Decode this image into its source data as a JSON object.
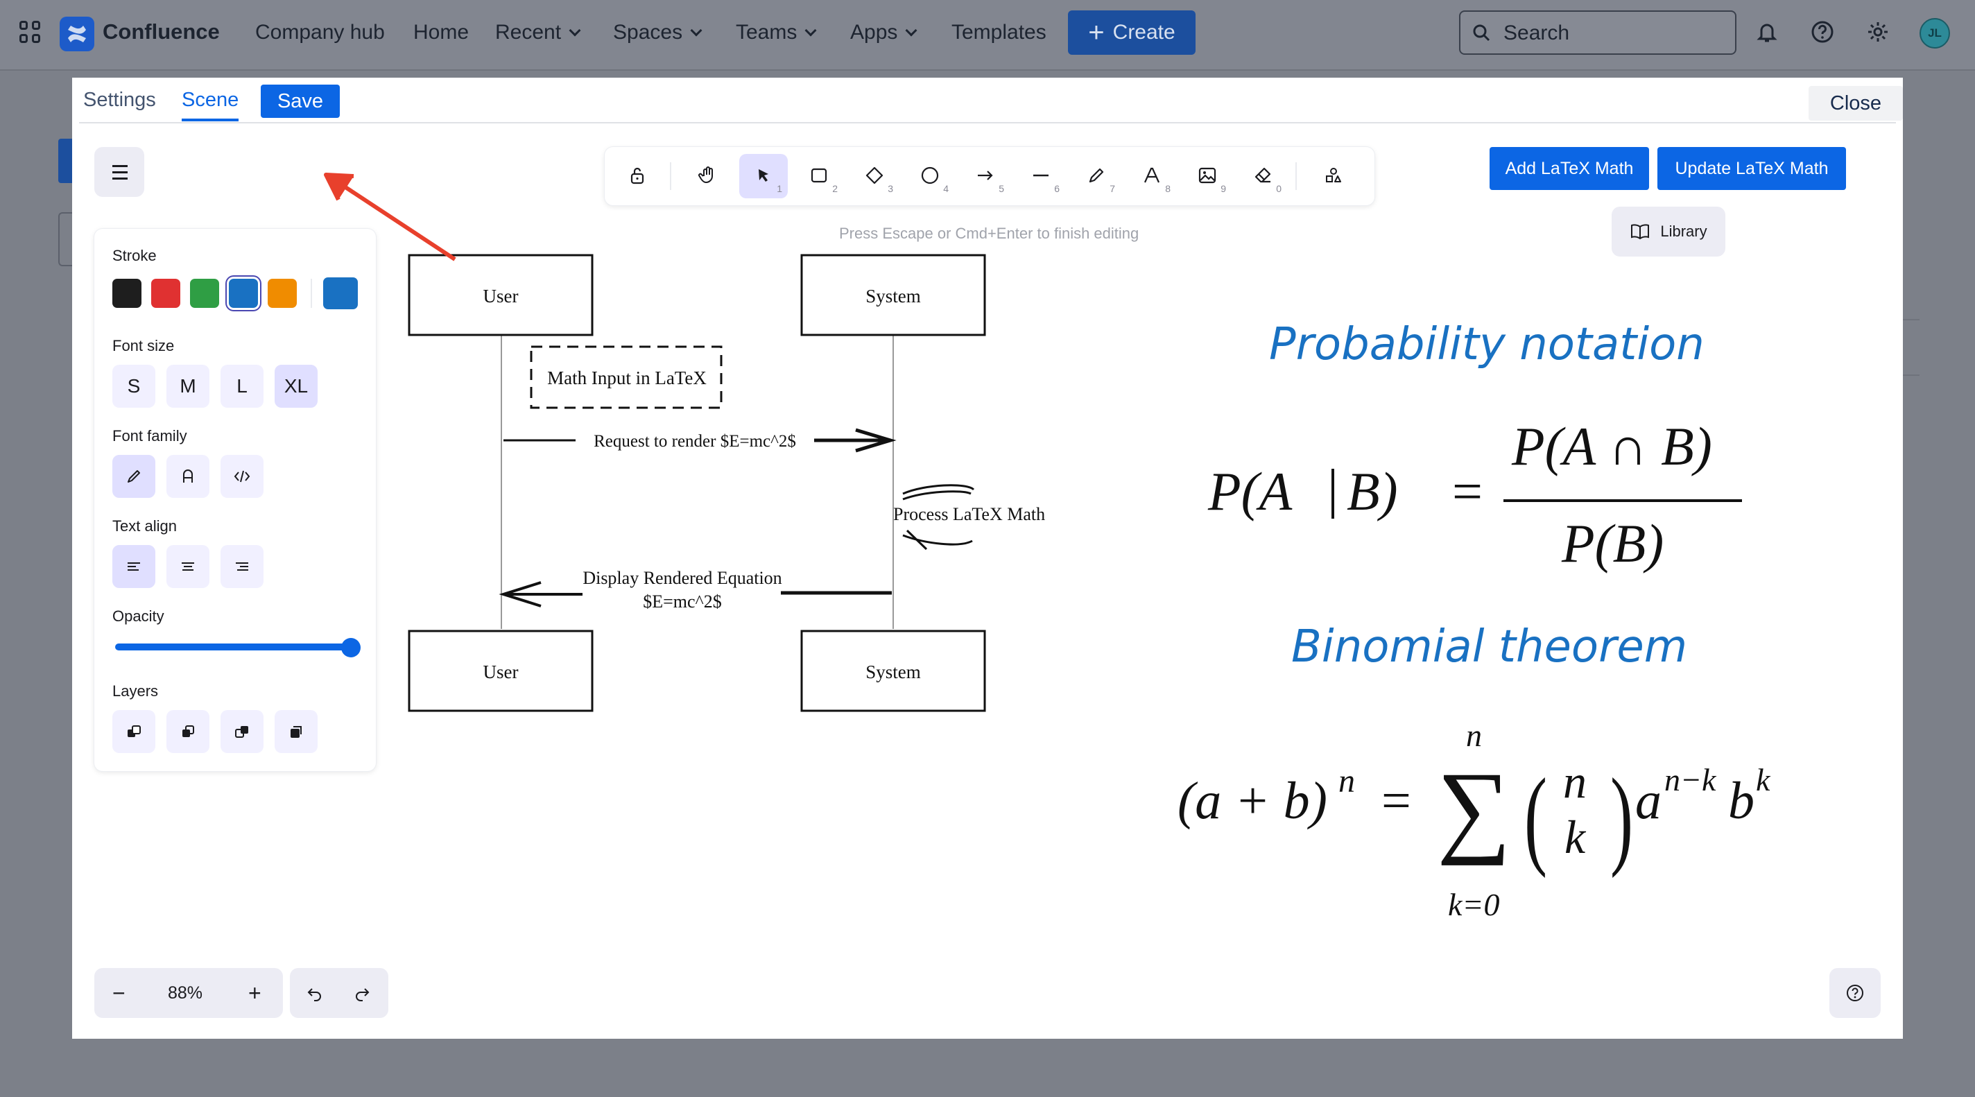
{
  "nav": {
    "brand": "Confluence",
    "items": [
      "Company hub",
      "Home",
      "Recent",
      "Spaces",
      "Teams",
      "Apps",
      "Templates"
    ],
    "create_label": "Create",
    "search_placeholder": "Search",
    "avatar_initials": "JL"
  },
  "modal": {
    "tabs": {
      "settings": "Settings",
      "scene": "Scene"
    },
    "save_label": "Save",
    "close_label": "Close"
  },
  "toolbar": {
    "keys": [
      "1",
      "2",
      "3",
      "4",
      "5",
      "6",
      "7",
      "8",
      "9",
      "0"
    ],
    "hint": "Press Escape or Cmd+Enter to finish editing"
  },
  "actions": {
    "add_latex": "Add LaTeX Math",
    "update_latex": "Update LaTeX Math",
    "library": "Library"
  },
  "panel": {
    "stroke_label": "Stroke",
    "stroke_colors": [
      "#1e1e1e",
      "#e03131",
      "#2f9e44",
      "#1971c2",
      "#f08c00"
    ],
    "stroke_selected": "#1971c2",
    "font_size_label": "Font size",
    "font_sizes": [
      "S",
      "M",
      "L",
      "XL"
    ],
    "font_size_selected": "XL",
    "font_family_label": "Font family",
    "text_align_label": "Text align",
    "opacity_label": "Opacity",
    "opacity_value": 100,
    "layers_label": "Layers"
  },
  "zoom": {
    "value": "88%"
  },
  "diagram": {
    "user_top": "User",
    "system_top": "System",
    "note": "Math Input in LaTeX",
    "request": "Request to render $E=mc^2$",
    "process": "Process LaTeX Math",
    "display_line1": "Display Rendered Equation",
    "display_line2": "$E=mc^2$",
    "user_bottom": "User",
    "system_bottom": "System"
  },
  "notes": {
    "probability_title": "Probability notation",
    "binomial_title": "Binomial theorem"
  },
  "colors": {
    "accent": "#0c66e4",
    "annotation_arrow": "#e8402c",
    "handwriting": "#1971c2"
  }
}
